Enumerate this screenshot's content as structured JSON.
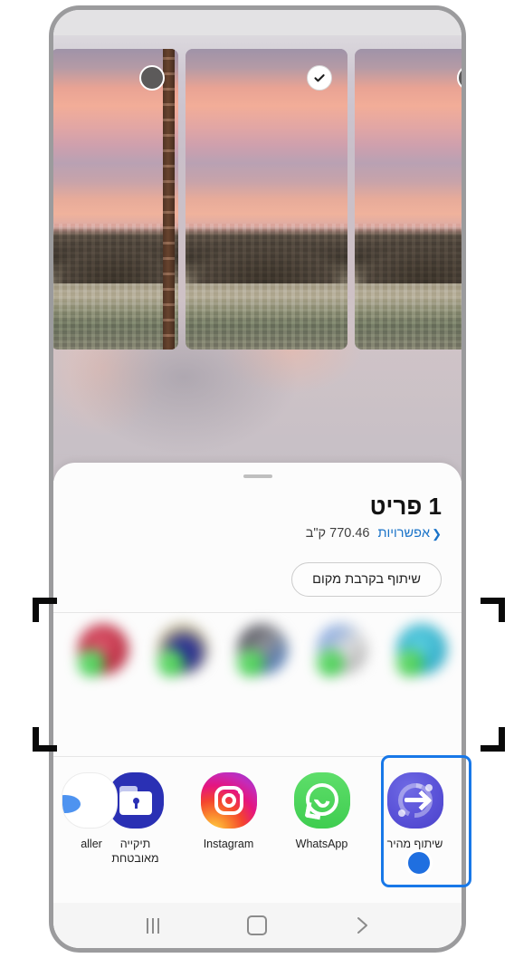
{
  "device": {
    "frame_color": "#9b9b9d",
    "screen_background": "#ffffff"
  },
  "gallery": {
    "thumbnails": [
      {
        "name": "photo-thumbnail-1",
        "selected": false,
        "selection_state": "unselected",
        "description": "sunset-hillside-town"
      },
      {
        "name": "photo-thumbnail-2",
        "selected": true,
        "selection_state": "selected",
        "description": "sunset-hillside-town"
      },
      {
        "name": "photo-thumbnail-3",
        "selected": false,
        "selection_state": "unselected",
        "description": "sunset-hillside-town"
      }
    ]
  },
  "share_sheet": {
    "item_count_label": "1 פריט",
    "file_size": "770.46 ק\"ב",
    "options_label": "אפשרויות",
    "options_chevron": "❮",
    "nearby_share_label": "שיתוף בקרבת מקום",
    "link_color": "#1a73c8"
  },
  "suggestions": {
    "blurred": true,
    "items": [
      {
        "label": "",
        "avatar_color": "#3fb6cd"
      },
      {
        "label": "",
        "avatar_color": "#dcdcdc"
      },
      {
        "label": "",
        "avatar_color": "#4a4a52"
      },
      {
        "label": "",
        "avatar_color": "#cfc59a"
      },
      {
        "label": "",
        "avatar_color": "#c23a4a"
      }
    ]
  },
  "apps": {
    "items": [
      {
        "label": "aller",
        "icon": "caller-icon",
        "partial": true,
        "highlighted": false
      },
      {
        "label": "תיקייה\nמאובטחת",
        "icon": "secure-folder-icon",
        "partial": false,
        "highlighted": false
      },
      {
        "label": "Instagram",
        "icon": "instagram-icon",
        "partial": false,
        "highlighted": false
      },
      {
        "label": "WhatsApp",
        "icon": "whatsapp-icon",
        "partial": false,
        "highlighted": false
      },
      {
        "label": "שיתוף מהיר",
        "icon": "quick-share-icon",
        "partial": false,
        "highlighted": true
      }
    ],
    "highlight_color": "#1878e8",
    "touch_indicator_color": "#1f6fe0"
  },
  "nav_bar": {
    "recents_label": "recents",
    "home_label": "home",
    "back_label": "back",
    "back_glyph": "❯"
  }
}
